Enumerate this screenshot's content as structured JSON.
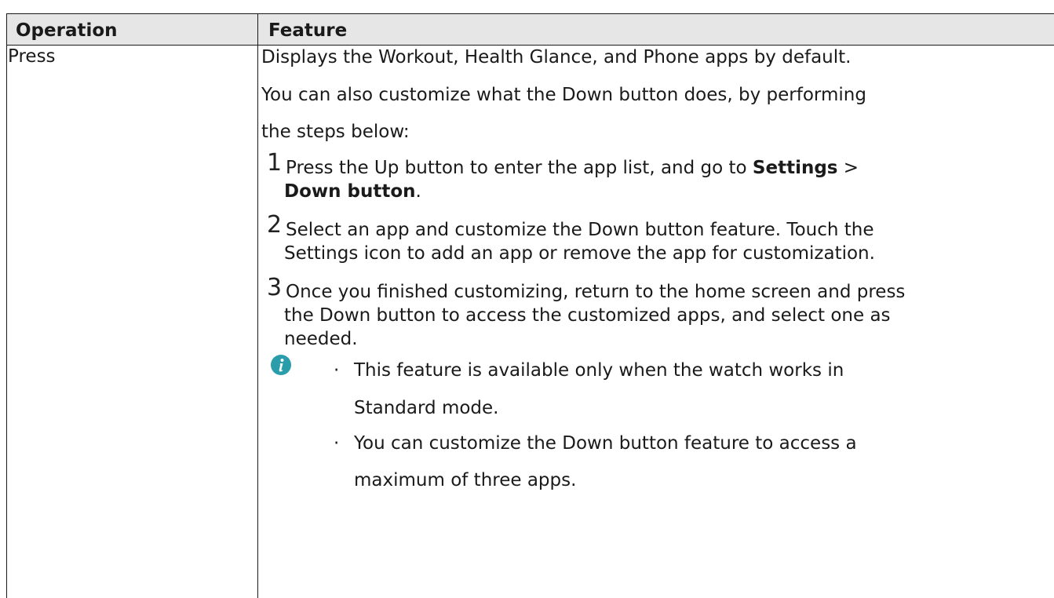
{
  "table": {
    "headers": {
      "operation": "Operation",
      "feature": "Feature"
    },
    "row": {
      "operation": "Press",
      "feature": {
        "intro_1": "Displays the Workout, Health Glance, and Phone apps by default.",
        "intro_2": "You can also customize what the Down button does, by performing",
        "intro_3": "the steps below:",
        "steps": [
          {
            "number": "1",
            "line_1_text": "Press the Up button to enter the app list, and go to ",
            "line_1_bold": "Settings",
            "line_1_tail": " >",
            "line_2_bold": "Down button",
            "line_2_tail": "."
          },
          {
            "number": "2",
            "line_1": "Select an app and customize the Down button feature. Touch the",
            "line_2": "Settings icon to add an app or remove the app for customization."
          },
          {
            "number": "3",
            "line_1": "Once you finished customizing, return to the home screen and press",
            "line_2": "the Down button to access the customized apps, and select one as",
            "line_3": "needed."
          }
        ],
        "note": {
          "icon": "info-icon",
          "icon_color": "#2a9dab",
          "bullets": [
            {
              "line_1": "This feature is available only when the watch works in",
              "line_2": "Standard mode."
            },
            {
              "line_1": "You can customize the Down button feature to access a",
              "line_2": "maximum of three apps."
            }
          ]
        }
      }
    }
  }
}
